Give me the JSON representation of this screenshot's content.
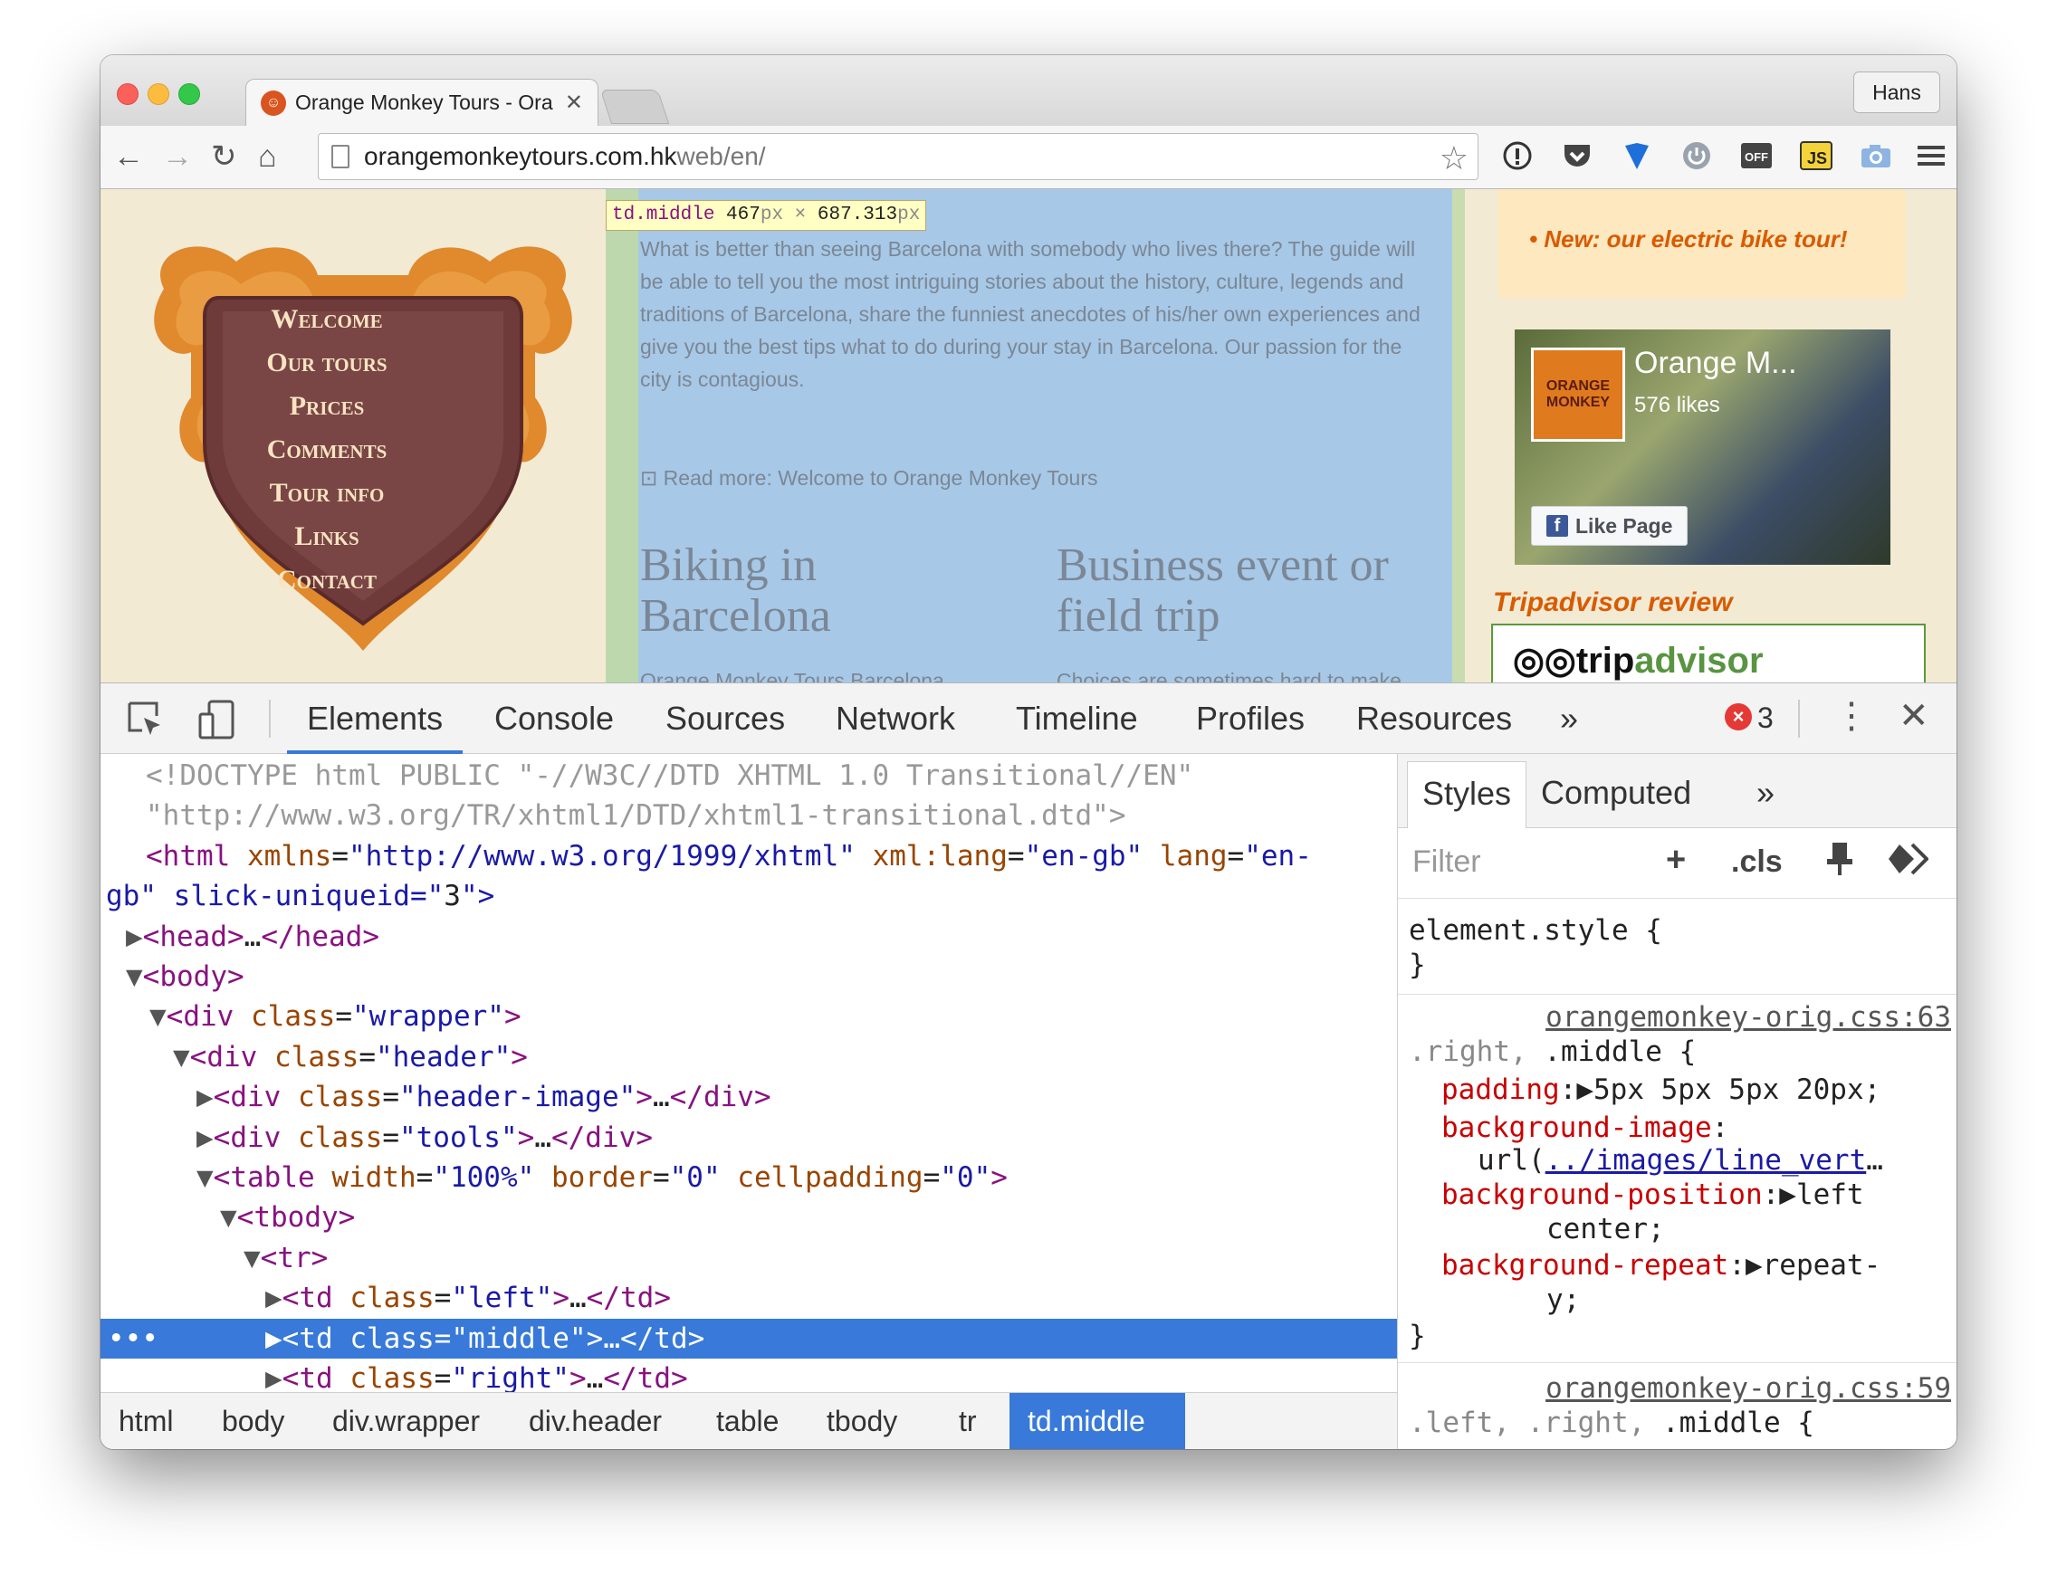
{
  "browser": {
    "tab_title": "Orange Monkey Tours - Ora",
    "tab_close": "✕",
    "profile": "Hans",
    "url_host": "orangemonkeytours.com.hk",
    "url_path": "web/en/"
  },
  "site": {
    "nav": [
      "Welcome",
      "Our tours",
      "Prices",
      "Comments",
      "Tour info",
      "Links",
      "Contact"
    ],
    "intro": "What is better than seeing Barcelona with somebody who lives there? The guide will be able to tell you the most intriguing stories about the history, culture, legends and traditions of Barcelona, share the funniest anecdotes of his/her own experiences and give you the best tips what to do during your stay in Barcelona. Our passion for the city is contagious.",
    "read_more": "Read more: Welcome to Orange Monkey Tours",
    "heading1": "Biking in Barcelona",
    "heading2": "Business event or field trip",
    "para1": "Orange Monkey Tours Barcelona offers you the opportunity for",
    "para2": "Choices are sometimes hard to make. Especially when you are unknown in",
    "news_item": "New: our electric bike tour!",
    "fb_name": "Orange M...",
    "fb_likes": "576 likes",
    "fb_button": "Like Page",
    "fb_logo": "ORANGE MONKEY",
    "trip_title": "Tripadvisor review",
    "trip_logo_a": "trip",
    "trip_logo_b": "advisor"
  },
  "inspect_tooltip": {
    "tag": "td.middle",
    "width": "467",
    "unit1": "px",
    "times": "×",
    "height": "687.313",
    "unit2": "px"
  },
  "devtools": {
    "tabs": [
      "Elements",
      "Console",
      "Sources",
      "Network",
      "Timeline",
      "Profiles",
      "Resources"
    ],
    "more": "»",
    "error_count": "3",
    "dom_lines": [
      {
        "indent": 1,
        "html": "<!DOCTYPE html PUBLIC \"-//W3C//DTD XHTML 1.0 Transitional//EN\""
      },
      {
        "indent": 1,
        "html": "\"http://www.w3.org/TR/xhtml1/DTD/xhtml1-transitional.dtd\">"
      },
      {
        "indent": 1,
        "html": "<html xmlns=\"http://www.w3.org/1999/xhtml\" xml:lang=\"en-gb\" lang=\"en-"
      },
      {
        "indent": 0,
        "html": "gb\" slick-uniqueid=\"3\">"
      },
      {
        "indent": 1,
        "html": "▶<head>…</head>"
      },
      {
        "indent": 1,
        "html": "▼<body>"
      },
      {
        "indent": 2,
        "html": "▼<div class=\"wrapper\">"
      },
      {
        "indent": 3,
        "html": "▼<div class=\"header\">"
      },
      {
        "indent": 4,
        "html": "▶<div class=\"header-image\">…</div>"
      },
      {
        "indent": 4,
        "html": "▶<div class=\"tools\">…</div>"
      },
      {
        "indent": 4,
        "html": "▼<table width=\"100%\" border=\"0\" cellpadding=\"0\">"
      },
      {
        "indent": 5,
        "html": "▼<tbody>"
      },
      {
        "indent": 6,
        "html": "▼<tr>"
      },
      {
        "indent": 7,
        "html": "▶<td class=\"left\">…</td>"
      },
      {
        "indent": 7,
        "html": "▶<td class=\"middle\">…</td>"
      },
      {
        "indent": 7,
        "html": "▶<td class=\"right\">…</td>"
      }
    ],
    "selected_dots": "•••",
    "breadcrumbs": [
      "html",
      "body",
      "div.wrapper",
      "div.header",
      "table",
      "tbody",
      "tr",
      "td.middle"
    ],
    "side_tabs": [
      "Styles",
      "Computed"
    ],
    "filter_placeholder": "Filter",
    "filter_add": "+",
    "filter_cls": ".cls",
    "styles": {
      "element_style": "element.style {",
      "close": "}",
      "rule1_src": "orangemonkey-orig.css:63",
      "rule1_sel": ".right, .middle {",
      "rule1_props": [
        {
          "name": "padding",
          "value": "▶5px 5px 5px 20px;"
        },
        {
          "name": "background-image",
          "value": ""
        },
        {
          "name": "",
          "value": "url(../images/line_vert…"
        },
        {
          "name": "background-position",
          "value": "▶left"
        },
        {
          "name": "",
          "value": "center;"
        },
        {
          "name": "background-repeat",
          "value": "▶repeat-"
        },
        {
          "name": "",
          "value": "y;"
        }
      ],
      "rule2_src": "orangemonkey-orig.css:59",
      "rule2_sel": ".left, .right, .middle {"
    }
  },
  "colors": {
    "accent": "#3879d9",
    "highlight_blue": "#a7c8e6",
    "orange": "#d95b00",
    "page_bg": "#f3ead4"
  }
}
